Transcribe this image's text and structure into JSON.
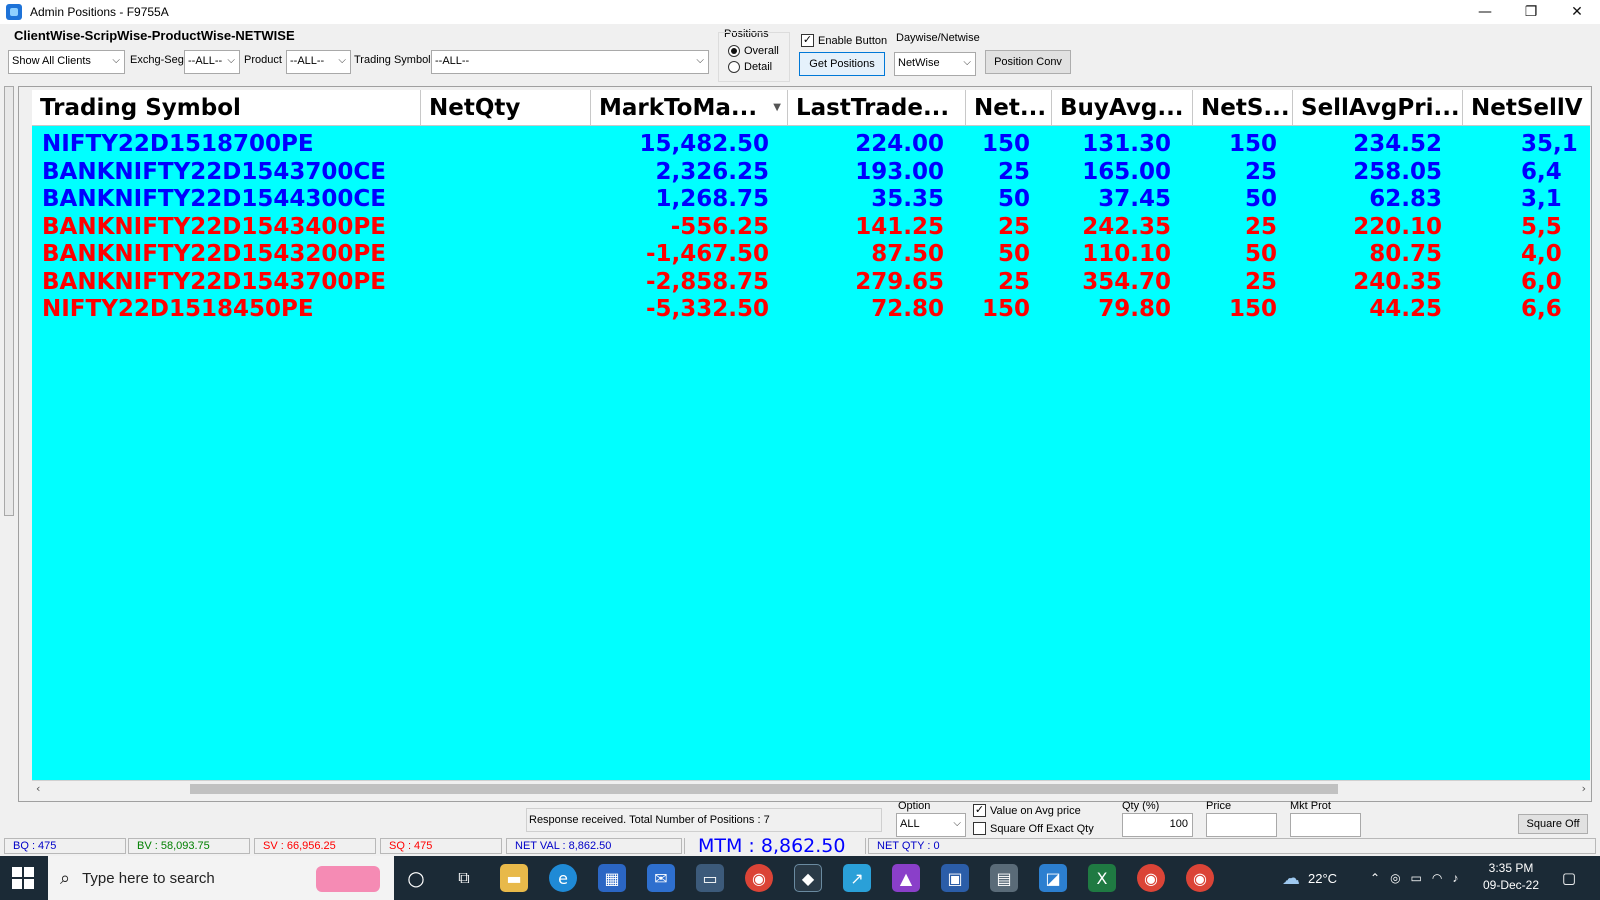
{
  "window": {
    "title": "Admin Positions - F9755A",
    "min": "—",
    "restore": "❐",
    "close": "✕"
  },
  "toolbar": {
    "heading": "ClientWise-ScripWise-ProductWise-NETWISE",
    "clients_value": "Show All Clients",
    "exchg_label": "Exchg-Seg",
    "exchg_value": "--ALL--",
    "product_label": "Product",
    "product_value": "--ALL--",
    "symbol_label": "Trading Symbol",
    "symbol_value": "--ALL--",
    "positions_label": "Positions",
    "radio_overall": "Overall",
    "radio_detail": "Detail",
    "enable_label": "Enable Button",
    "get_positions": "Get Positions",
    "daywise_label": "Daywise/Netwise",
    "daywise_value": "NetWise",
    "position_conv": "Position Conv"
  },
  "grid": {
    "columns": [
      "Trading Symbol",
      "NetQty",
      "MarkToMa...",
      "LastTrade...",
      "Net...",
      "BuyAvg...",
      "NetS...",
      "SellAvgPri...",
      "NetSellV"
    ],
    "colors": {
      "positive": "#0000ff",
      "negative": "#ff0000",
      "background": "#00ffff"
    },
    "rows": [
      {
        "symbol": "NIFTY22D1518700PE",
        "mtm": "15,482.50",
        "ltp": "224.00",
        "netbuy": "150",
        "buyavg": "131.30",
        "netsell": "150",
        "sellavg": "234.52",
        "netsellv": "35,1",
        "sign": "positive"
      },
      {
        "symbol": "BANKNIFTY22D1543700CE",
        "mtm": "2,326.25",
        "ltp": "193.00",
        "netbuy": "25",
        "buyavg": "165.00",
        "netsell": "25",
        "sellavg": "258.05",
        "netsellv": "6,4",
        "sign": "positive"
      },
      {
        "symbol": "BANKNIFTY22D1544300CE",
        "mtm": "1,268.75",
        "ltp": "35.35",
        "netbuy": "50",
        "buyavg": "37.45",
        "netsell": "50",
        "sellavg": "62.83",
        "netsellv": "3,1",
        "sign": "positive"
      },
      {
        "symbol": "BANKNIFTY22D1543400PE",
        "mtm": "-556.25",
        "ltp": "141.25",
        "netbuy": "25",
        "buyavg": "242.35",
        "netsell": "25",
        "sellavg": "220.10",
        "netsellv": "5,5",
        "sign": "negative"
      },
      {
        "symbol": "BANKNIFTY22D1543200PE",
        "mtm": "-1,467.50",
        "ltp": "87.50",
        "netbuy": "50",
        "buyavg": "110.10",
        "netsell": "50",
        "sellavg": "80.75",
        "netsellv": "4,0",
        "sign": "negative"
      },
      {
        "symbol": "BANKNIFTY22D1543700PE",
        "mtm": "-2,858.75",
        "ltp": "279.65",
        "netbuy": "25",
        "buyavg": "354.70",
        "netsell": "25",
        "sellavg": "240.35",
        "netsellv": "6,0",
        "sign": "negative"
      },
      {
        "symbol": "NIFTY22D1518450PE",
        "mtm": "-5,332.50",
        "ltp": "72.80",
        "netbuy": "150",
        "buyavg": "79.80",
        "netsell": "150",
        "sellavg": "44.25",
        "netsellv": "6,6",
        "sign": "negative"
      }
    ]
  },
  "bottom": {
    "response": "Response received. Total Number of Positions : 7",
    "option_label": "Option",
    "option_value": "ALL",
    "value_on_avg": "Value on Avg  price",
    "square_exact": "Square Off Exact Qty",
    "qty_label": "Qty (%)",
    "qty_value": "100",
    "price_label": "Price",
    "mktprot_label": "Mkt Prot",
    "square_off": "Square Off"
  },
  "status": {
    "bq": "BQ : 475",
    "bv": "BV : 58,093.75",
    "sv": "SV : 66,956.25",
    "sq": "SQ : 475",
    "netval": "NET VAL : 8,862.50",
    "mtm": "MTM : 8,862.50",
    "netqty": "NET QTY : 0"
  },
  "taskbar": {
    "search_placeholder": "Type here to search",
    "weather": "22°C",
    "time": "3:35 PM",
    "date": "09-Dec-22"
  }
}
